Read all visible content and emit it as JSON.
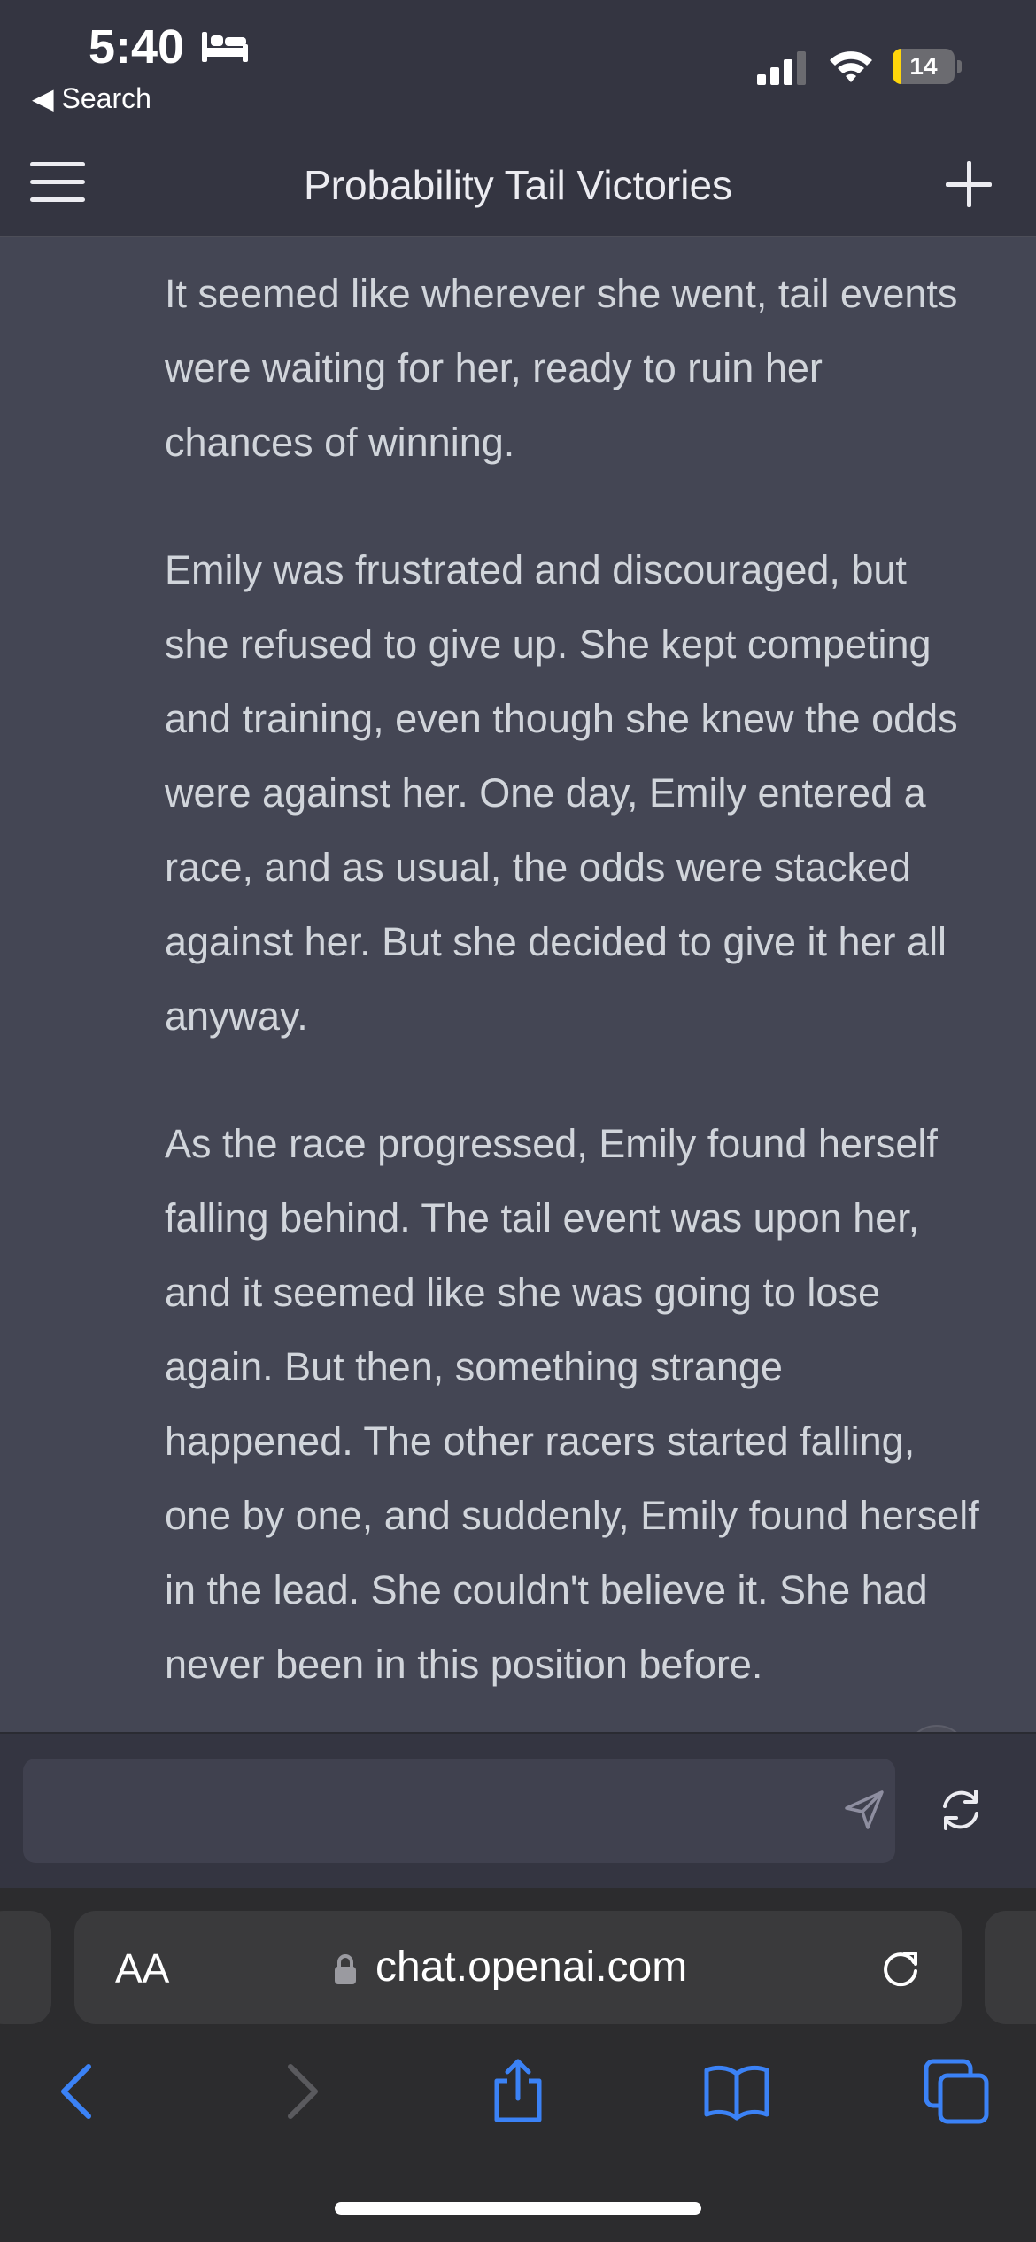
{
  "status_bar": {
    "time": "5:40",
    "back_label": "◀ Search",
    "battery_level": "14",
    "battery_fraction": 0.14
  },
  "header": {
    "title": "Probability Tail Victories"
  },
  "messages": {
    "paragraphs": [
      "It seemed like wherever she went, tail events were waiting for her, ready to ruin her chances of winning.",
      "Emily was frustrated and discouraged, but she refused to give up. She kept competing and training, even though she knew the odds were against her. One day, Emily entered a race, and as usual, the odds were stacked against her. But she decided to give it her all anyway.",
      "As the race progressed, Emily found herself falling behind. The tail event was upon her, and it seemed like she was going to lose again. But then, something strange happened. The other racers started falling, one by one, and suddenly, Emily found herself in the lead. She couldn't believe it. She had never been in this position before."
    ]
  },
  "composer": {
    "placeholder": ""
  },
  "browser": {
    "aa_label": "AA",
    "url": "chat.openai.com"
  },
  "colors": {
    "accent": "#3b82f6",
    "background": "#343541",
    "message_bg": "#444654"
  }
}
